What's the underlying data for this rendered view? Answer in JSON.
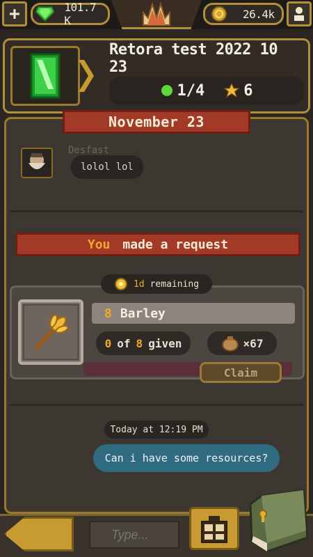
{
  "topbar": {
    "plus_icon": "plus-icon",
    "gems": "101.7 K",
    "coins": "26.4k",
    "crown_icon": "crown-icon",
    "profile_icon": "person-icon"
  },
  "header": {
    "title": "Retora test 2022 10 23",
    "members": "1/4",
    "stars": "6",
    "gem_icon": "green-gem-icon",
    "colors": {
      "panel_border": "#b0903a",
      "online_dot": "#5fd63a",
      "star": "#f0b838"
    }
  },
  "chat": {
    "date": "November 23",
    "messages": [
      {
        "author": "Desfast",
        "text": "lolol lol"
      }
    ],
    "request": {
      "actor": "You",
      "action": "made a request",
      "remaining_count": "1d",
      "remaining_label": "remaining",
      "item_qty": "8",
      "item_name": "Barley",
      "given": "0",
      "of_label": "of",
      "total": "8",
      "given_label": "given",
      "resource_count": "×67",
      "claim_label": "Claim"
    },
    "my_message": {
      "timestamp": "Today at 12:19 PM",
      "text": "Can i have some resources?"
    },
    "colors": {
      "ribbon": "#a33a27",
      "you": "#f0a826",
      "my_bubble": "#2f6c82"
    }
  },
  "bottombar": {
    "input_placeholder": "Type...",
    "back_icon": "arrow-left-icon",
    "gift_icon": "gift-icon",
    "book_icon": "book-icon"
  }
}
